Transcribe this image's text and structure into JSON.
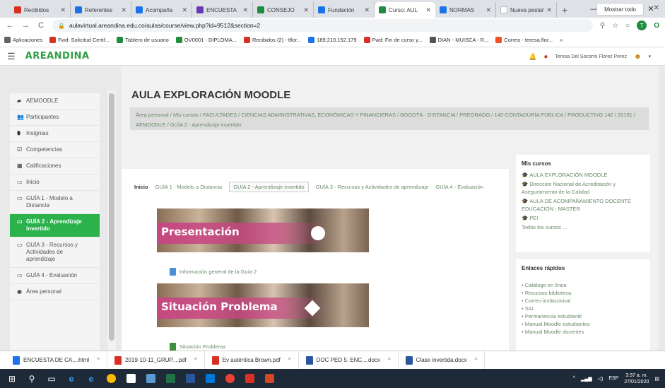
{
  "browser": {
    "tabs": [
      {
        "label": "Recibidos",
        "color": "#d93025"
      },
      {
        "label": "Referentes",
        "color": "#1a73e8"
      },
      {
        "label": "Acompaña",
        "color": "#1a73e8"
      },
      {
        "label": "ENCUESTA",
        "color": "#673ab7"
      },
      {
        "label": "CONSEJO",
        "color": "#1e8e3e"
      },
      {
        "label": "Fundación",
        "color": "#1a73e8"
      },
      {
        "label": "Curso: AUL",
        "color": "#1e8e3e",
        "active": true
      },
      {
        "label": "NORMAS",
        "color": "#1a73e8"
      },
      {
        "label": "Nueva pestaña",
        "color": "#ffffff"
      }
    ],
    "new_tab": "+",
    "window_buttons": [
      "—",
      "❐",
      "✕"
    ],
    "nav": {
      "back": "←",
      "forward": "→",
      "reload": "C"
    },
    "url": "aulavirtual.areandina.edu.co/aulas/course/view.php?id=9512&section=2",
    "addr_icons": [
      "⚲",
      "☆",
      "○"
    ],
    "profile_letter": "T",
    "bookmarks": [
      {
        "label": "Aplicaciones",
        "color": "#5f6368"
      },
      {
        "label": "Fwd: Solicitud Certif...",
        "color": "#d93025"
      },
      {
        "label": "Tablero de usuario",
        "color": "#1e8e3e"
      },
      {
        "label": "OV0001 - DIPLOMA...",
        "color": "#1e8e3e"
      },
      {
        "label": "Recibidos (2) - tflor...",
        "color": "#d93025"
      },
      {
        "label": "189.210.152.179",
        "color": "#1a73e8"
      },
      {
        "label": "Fwd: Fin de curso y...",
        "color": "#d93025"
      },
      {
        "label": "DIAN - MUISCA - R...",
        "color": "#555555"
      },
      {
        "label": "Correo - teresa.flor...",
        "color": "#f4511e"
      }
    ],
    "bookmarks_more": "»"
  },
  "site": {
    "brand": "AREANDINA",
    "user_name": "Teresa Del Socorro Florez Perez"
  },
  "sidebar": {
    "items": [
      {
        "icon": "▰",
        "label": "AEMOODLE"
      },
      {
        "icon": "👥",
        "label": "Participantes"
      },
      {
        "icon": "⬮",
        "label": "Insignias"
      },
      {
        "icon": "☑",
        "label": "Competencias"
      },
      {
        "icon": "▦",
        "label": "Calificaciones"
      },
      {
        "icon": "▭",
        "label": "Inicio"
      },
      {
        "icon": "▭",
        "label": "GUÍA 1 - Modelo a Distancia"
      },
      {
        "icon": "▭",
        "label": "GUÍA 2 - Aprendizaje invertido",
        "active": true
      },
      {
        "icon": "▭",
        "label": "GUÍA 3 - Recursos y Actividades de aprendizaje"
      },
      {
        "icon": "▭",
        "label": "GUÍA 4 - Evaluación"
      },
      {
        "icon": "◉",
        "label": "Área personal"
      }
    ]
  },
  "main": {
    "title": "AULA EXPLORACIÓN MOODLE",
    "breadcrumb": "Área personal / Mis cursos / FACULTADES / CIENCIAS ADMINISTRATIVAS, ECONÓMICAS Y FINANCIERAS / BOGOTÁ - DISTANCIA / PREGRADO / 142-CONTADURÍA PÚBLICA / PRODUCTIVO 142 / 20191 / AEMOODLE / GUÍA 2 - Aprendizaje invertido",
    "section_tabs": [
      {
        "label": "Inicio",
        "current": true
      },
      {
        "label": "GUÍA 1 - Modelo a Distancia"
      },
      {
        "label": "GUÍA 2 - Aprendizaje invertido",
        "boxed": true
      },
      {
        "label": "GUÍA 3 - Recursos y Actividades de aprendizaje"
      },
      {
        "label": "GUÍA 4 - Evaluación"
      }
    ],
    "banner1": "Presentación",
    "file1": "Información general de la Guía 2",
    "banner2": "Situación Problema",
    "file2": "Situación Problema"
  },
  "right": {
    "mis_cursos_title": "Mis cursos",
    "mis_cursos": [
      "AULA EXPLORACIÓN MOODLE",
      "Direccion Nacional de Acreditación y Aseguramiento de la Calidad",
      "AULA DE ACOMPAÑAMIENTO DOCENTE EDUCACIÓN - MASTER",
      "PEI"
    ],
    "todos": "Todos los cursos ...",
    "enlaces_title": "Enlaces rápidos",
    "enlaces": [
      "Catálogo en línea",
      "Recursos biblioteca",
      "Correo institucional",
      "SAI",
      "Permanencia estudiantil",
      "Manual Moodle estudiantes",
      "Manual Moodle docentes"
    ]
  },
  "downloads": {
    "items": [
      {
        "label": "ENCUESTA DE CA....html",
        "color": "#1a73e8"
      },
      {
        "label": "2019-10-11_GRUP....pdf",
        "color": "#d93025"
      },
      {
        "label": "Ev auténtica Brown.pdf",
        "color": "#d93025"
      },
      {
        "label": "DOC PED 5. ENC....docx",
        "color": "#2b579a"
      },
      {
        "label": "Clase invertida.docx",
        "color": "#2b579a"
      }
    ],
    "show_all": "Mostrar todo",
    "close": "✕"
  },
  "taskbar": {
    "start": "⊞",
    "search": "⚲",
    "lang": "ESP",
    "time": "3:37 a. m.",
    "date": "27/01/2020"
  }
}
